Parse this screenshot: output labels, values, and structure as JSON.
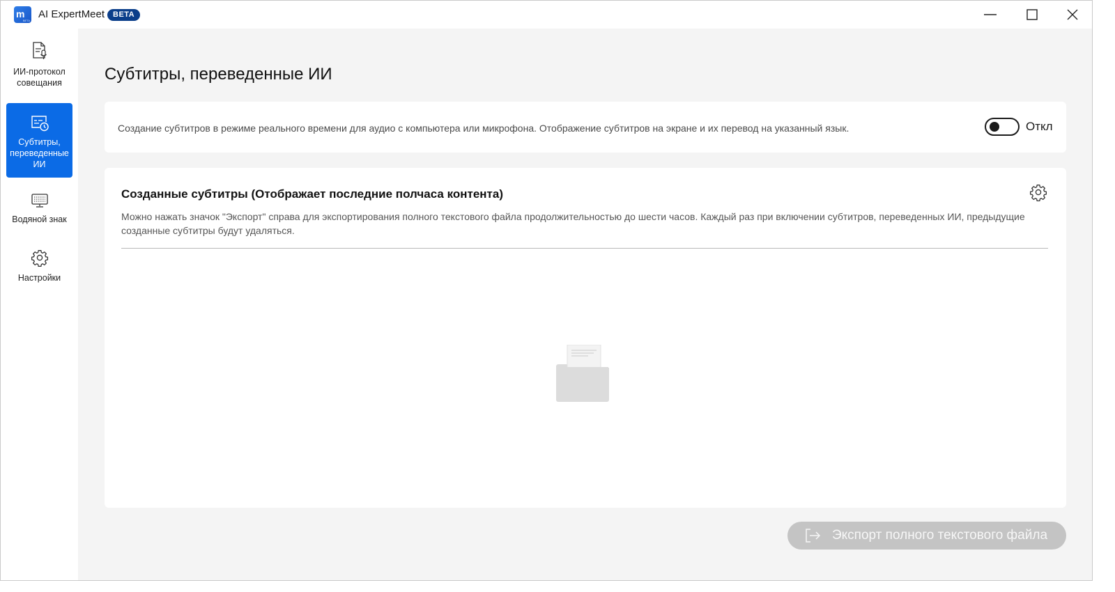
{
  "app": {
    "title": "AI ExpertMeet",
    "badge": "BETA",
    "logo_letter": "m",
    "logo_small": "BETA",
    "accent_color": "#0b6be6"
  },
  "window_controls": {
    "minimize_icon": "minimize-icon",
    "maximize_icon": "maximize-icon",
    "close_icon": "close-icon"
  },
  "sidebar": {
    "items": [
      {
        "label": "ИИ-протокол совещания",
        "icon": "meeting-minutes-icon",
        "active": false
      },
      {
        "label": "Субтитры, переведенные ИИ",
        "icon": "subtitles-clock-icon",
        "active": true
      },
      {
        "label": "Водяной знак",
        "icon": "watermark-icon",
        "active": false
      },
      {
        "label": "Настройки",
        "icon": "gear-icon",
        "active": false
      }
    ]
  },
  "main": {
    "page_title": "Субтитры, переведенные ИИ",
    "feature_card": {
      "description": "Создание субтитров в режиме реального времени для аудио с компьютера или микрофона. Отображение субтитров на экране и их перевод на указанный язык.",
      "toggle_state": "off",
      "toggle_label": "Откл"
    },
    "subtitles_card": {
      "title": "Созданные субтитры (Отображает последние полчаса контента)",
      "description": "Можно нажать значок \"Экспорт\" справа для экспортирования полного текстового файла продолжительностью до шести часов. Каждый раз при включении субтитров, переведенных ИИ, предыдущие созданные субтитры будут удаляться.",
      "settings_icon": "gear-icon",
      "empty_icon": "empty-folder-icon"
    },
    "export_button": {
      "label": "Экспорт полного текстового файла",
      "icon": "export-icon",
      "disabled": true
    }
  }
}
